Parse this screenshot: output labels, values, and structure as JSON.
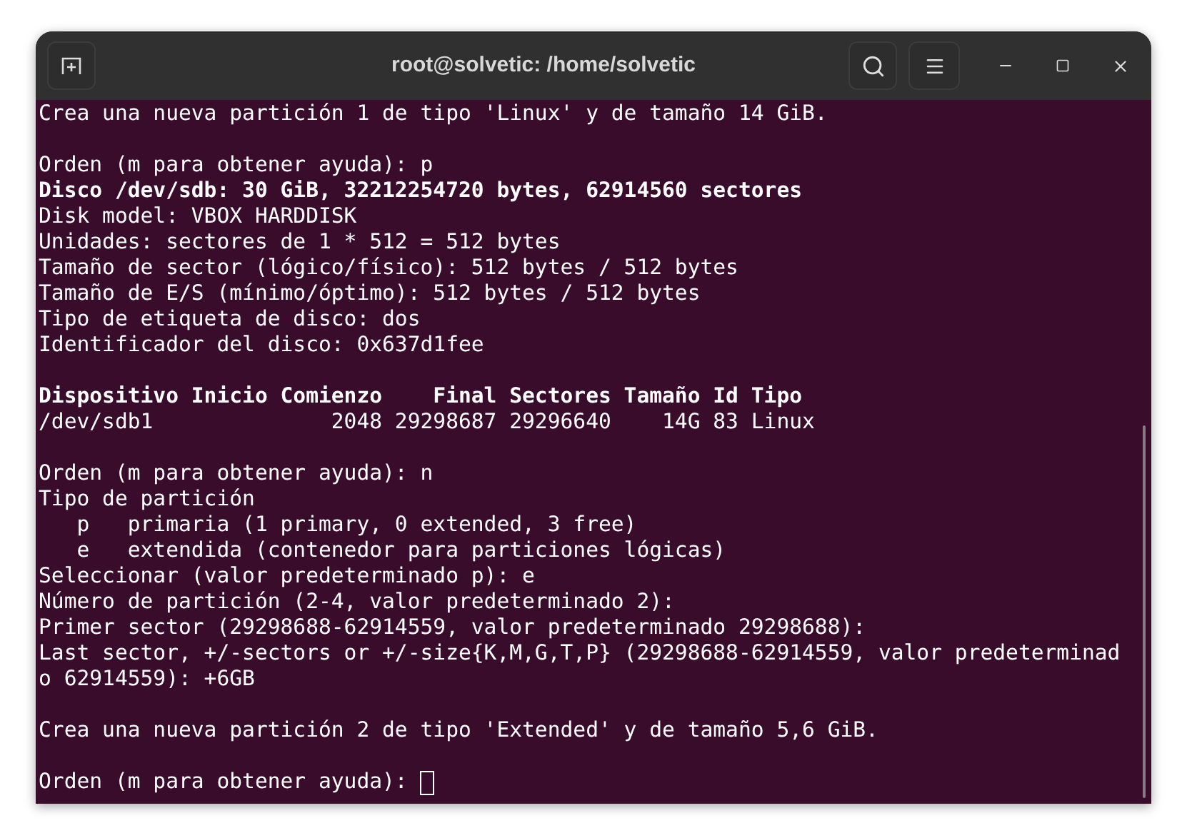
{
  "window": {
    "title": "root@solvetic: /home/solvetic"
  },
  "terminal": {
    "lines": [
      {
        "kind": "output",
        "text": "Crea una nueva partición 1 de tipo 'Linux' y de tamaño 14 GiB."
      },
      {
        "kind": "blank"
      },
      {
        "kind": "output",
        "text": "Orden (m para obtener ayuda): p"
      },
      {
        "kind": "bold",
        "text": "Disco /dev/sdb: 30 GiB, 32212254720 bytes, 62914560 sectores"
      },
      {
        "kind": "output",
        "text": "Disk model: VBOX HARDDISK"
      },
      {
        "kind": "output",
        "text": "Unidades: sectores de 1 * 512 = 512 bytes"
      },
      {
        "kind": "output",
        "text": "Tamaño de sector (lógico/físico): 512 bytes / 512 bytes"
      },
      {
        "kind": "output",
        "text": "Tamaño de E/S (mínimo/óptimo): 512 bytes / 512 bytes"
      },
      {
        "kind": "output",
        "text": "Tipo de etiqueta de disco: dos"
      },
      {
        "kind": "output",
        "text": "Identificador del disco: 0x637d1fee"
      },
      {
        "kind": "blank"
      },
      {
        "kind": "bold",
        "text": "Dispositivo Inicio Comienzo    Final Sectores Tamaño Id Tipo"
      },
      {
        "kind": "output",
        "text": "/dev/sdb1              2048 29298687 29296640    14G 83 Linux"
      },
      {
        "kind": "blank"
      },
      {
        "kind": "output",
        "text": "Orden (m para obtener ayuda): n"
      },
      {
        "kind": "output",
        "text": "Tipo de partición"
      },
      {
        "kind": "output",
        "text": "   p   primaria (1 primary, 0 extended, 3 free)"
      },
      {
        "kind": "output",
        "text": "   e   extendida (contenedor para particiones lógicas)"
      },
      {
        "kind": "output",
        "text": "Seleccionar (valor predeterminado p): e"
      },
      {
        "kind": "output",
        "text": "Número de partición (2-4, valor predeterminado 2):"
      },
      {
        "kind": "output",
        "text": "Primer sector (29298688-62914559, valor predeterminado 29298688):"
      },
      {
        "kind": "output",
        "text": "Last sector, +/-sectors or +/-size{K,M,G,T,P} (29298688-62914559, valor predeterminad"
      },
      {
        "kind": "output",
        "text": "o 62914559): +6GB"
      },
      {
        "kind": "blank"
      },
      {
        "kind": "output",
        "text": "Crea una nueva partición 2 de tipo 'Extended' y de tamaño 5,6 GiB."
      },
      {
        "kind": "blank"
      },
      {
        "kind": "prompt",
        "text": "Orden (m para obtener ayuda):"
      }
    ]
  }
}
